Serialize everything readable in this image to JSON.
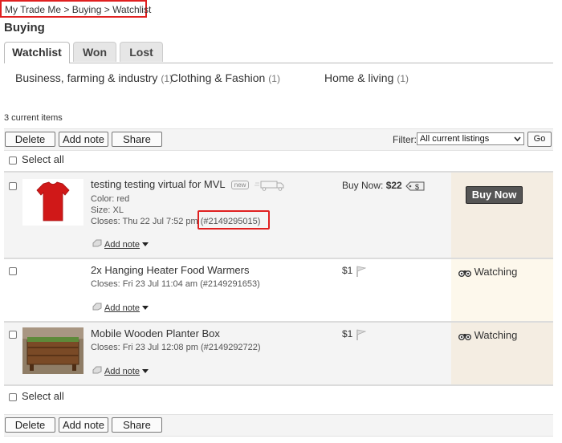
{
  "breadcrumb": "My Trade Me > Buying > Watchlist",
  "page_title": "Buying",
  "tabs": [
    "Watchlist",
    "Won",
    "Lost"
  ],
  "categories": [
    {
      "label": "Business, farming & industry",
      "count": "(1)"
    },
    {
      "label": "Clothing & Fashion",
      "count": "(1)"
    },
    {
      "label": "Home & living",
      "count": "(1)"
    }
  ],
  "current_items": "3 current items",
  "toolbar": {
    "delete": "Delete",
    "add_note": "Add note",
    "share": "Share",
    "filter_label": "Filter:",
    "filter_value": "All current listings",
    "go": "Go"
  },
  "select_all": "Select all",
  "add_note_link": "Add note",
  "items": [
    {
      "title": "testing testing virtual for MVL",
      "badge": "new",
      "color": "Color: red",
      "size": "Size: XL",
      "closes_prefix": "Closes: Thu 22 Jul 7:52 pm",
      "listing_id": "(#2149295015)",
      "price_label": "Buy Now:",
      "price": "$22",
      "action": "Buy Now"
    },
    {
      "title": "2x Hanging Heater Food Warmers",
      "closes": "Closes: Fri 23 Jul 11:04 am (#2149291653)",
      "price": "$1",
      "status": "Watching"
    },
    {
      "title": "Mobile Wooden Planter Box",
      "closes": "Closes: Fri 23 Jul 12:08 pm (#2149292722)",
      "price": "$1",
      "status": "Watching"
    }
  ],
  "colors": {
    "highlight": "#e02020",
    "buy_now_bg": "#f4ede2",
    "watching_bg": "#fdf8ec",
    "buy_button": "#555555"
  }
}
